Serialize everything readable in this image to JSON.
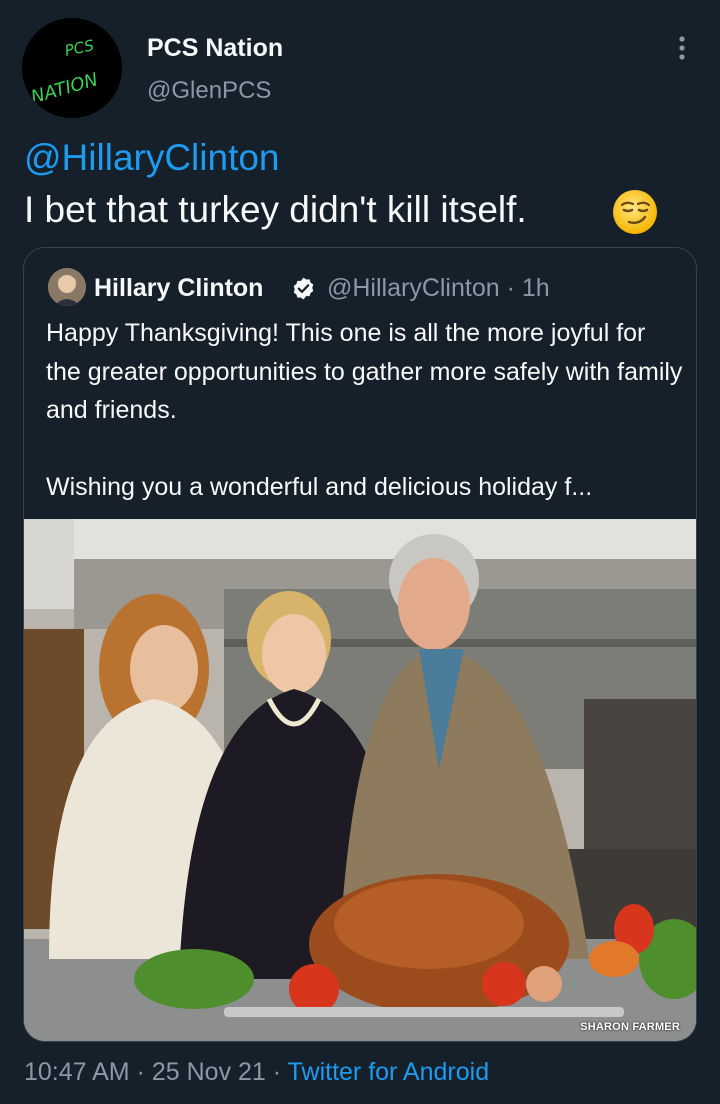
{
  "tweet": {
    "author": {
      "display_name": "PCS Nation",
      "handle": "@GlenPCS",
      "avatar_text_top": "PCS",
      "avatar_text_bottom": "NATION"
    },
    "mention": "@HillaryClinton",
    "text": "I bet that turkey didn't kill itself.",
    "emoji": "smirking-face",
    "time": "10:47 AM",
    "separator": "·",
    "date": "25 Nov 21",
    "source": "Twitter for Android"
  },
  "quoted": {
    "display_name": "Hillary Clinton",
    "handle": "@HillaryClinton",
    "age": "· 1h",
    "paragraph1": "Happy Thanksgiving! This one is all the more joyful for the greater opportunities to gather more safely with family and friends.",
    "paragraph2": "Wishing you a wonderful and delicious holiday f...",
    "photo_credit": "SHARON FARMER"
  },
  "colors": {
    "background": "#15202b",
    "text": "#f7f9f9",
    "secondary": "#8b98a5",
    "accent": "#1d9bf0",
    "border": "#38444d"
  },
  "icons": [
    "more-vertical-icon",
    "verified-badge-icon",
    "smirking-face-emoji"
  ]
}
